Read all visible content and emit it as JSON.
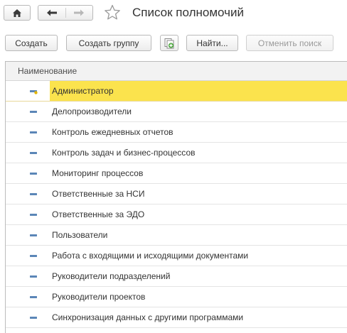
{
  "header": {
    "title": "Список полномочий"
  },
  "toolbar": {
    "create_label": "Создать",
    "create_group_label": "Создать группу",
    "find_label": "Найти...",
    "cancel_search_label": "Отменить поиск"
  },
  "table": {
    "column_header": "Наименование",
    "rows": [
      {
        "label": "Администратор",
        "selected": true
      },
      {
        "label": "Делопроизводители"
      },
      {
        "label": "Контроль ежедневных отчетов"
      },
      {
        "label": "Контроль задач и бизнес-процессов"
      },
      {
        "label": "Мониторинг процессов"
      },
      {
        "label": "Ответственные за НСИ"
      },
      {
        "label": "Ответственные за ЭДО"
      },
      {
        "label": "Пользователи"
      },
      {
        "label": "Работа с входящими и исходящими документами"
      },
      {
        "label": "Руководители подразделений"
      },
      {
        "label": "Руководители проектов"
      },
      {
        "label": "Синхронизация данных с другими программами"
      }
    ]
  },
  "colors": {
    "selection": "#fbe34d",
    "icon_blue": "#5b86b7"
  },
  "icons": {
    "home": "home-icon",
    "back": "arrow-left-icon",
    "forward": "arrow-right-icon",
    "favorite": "star-outline-icon",
    "copy": "copy-add-icon",
    "row": "dash-item-icon"
  }
}
